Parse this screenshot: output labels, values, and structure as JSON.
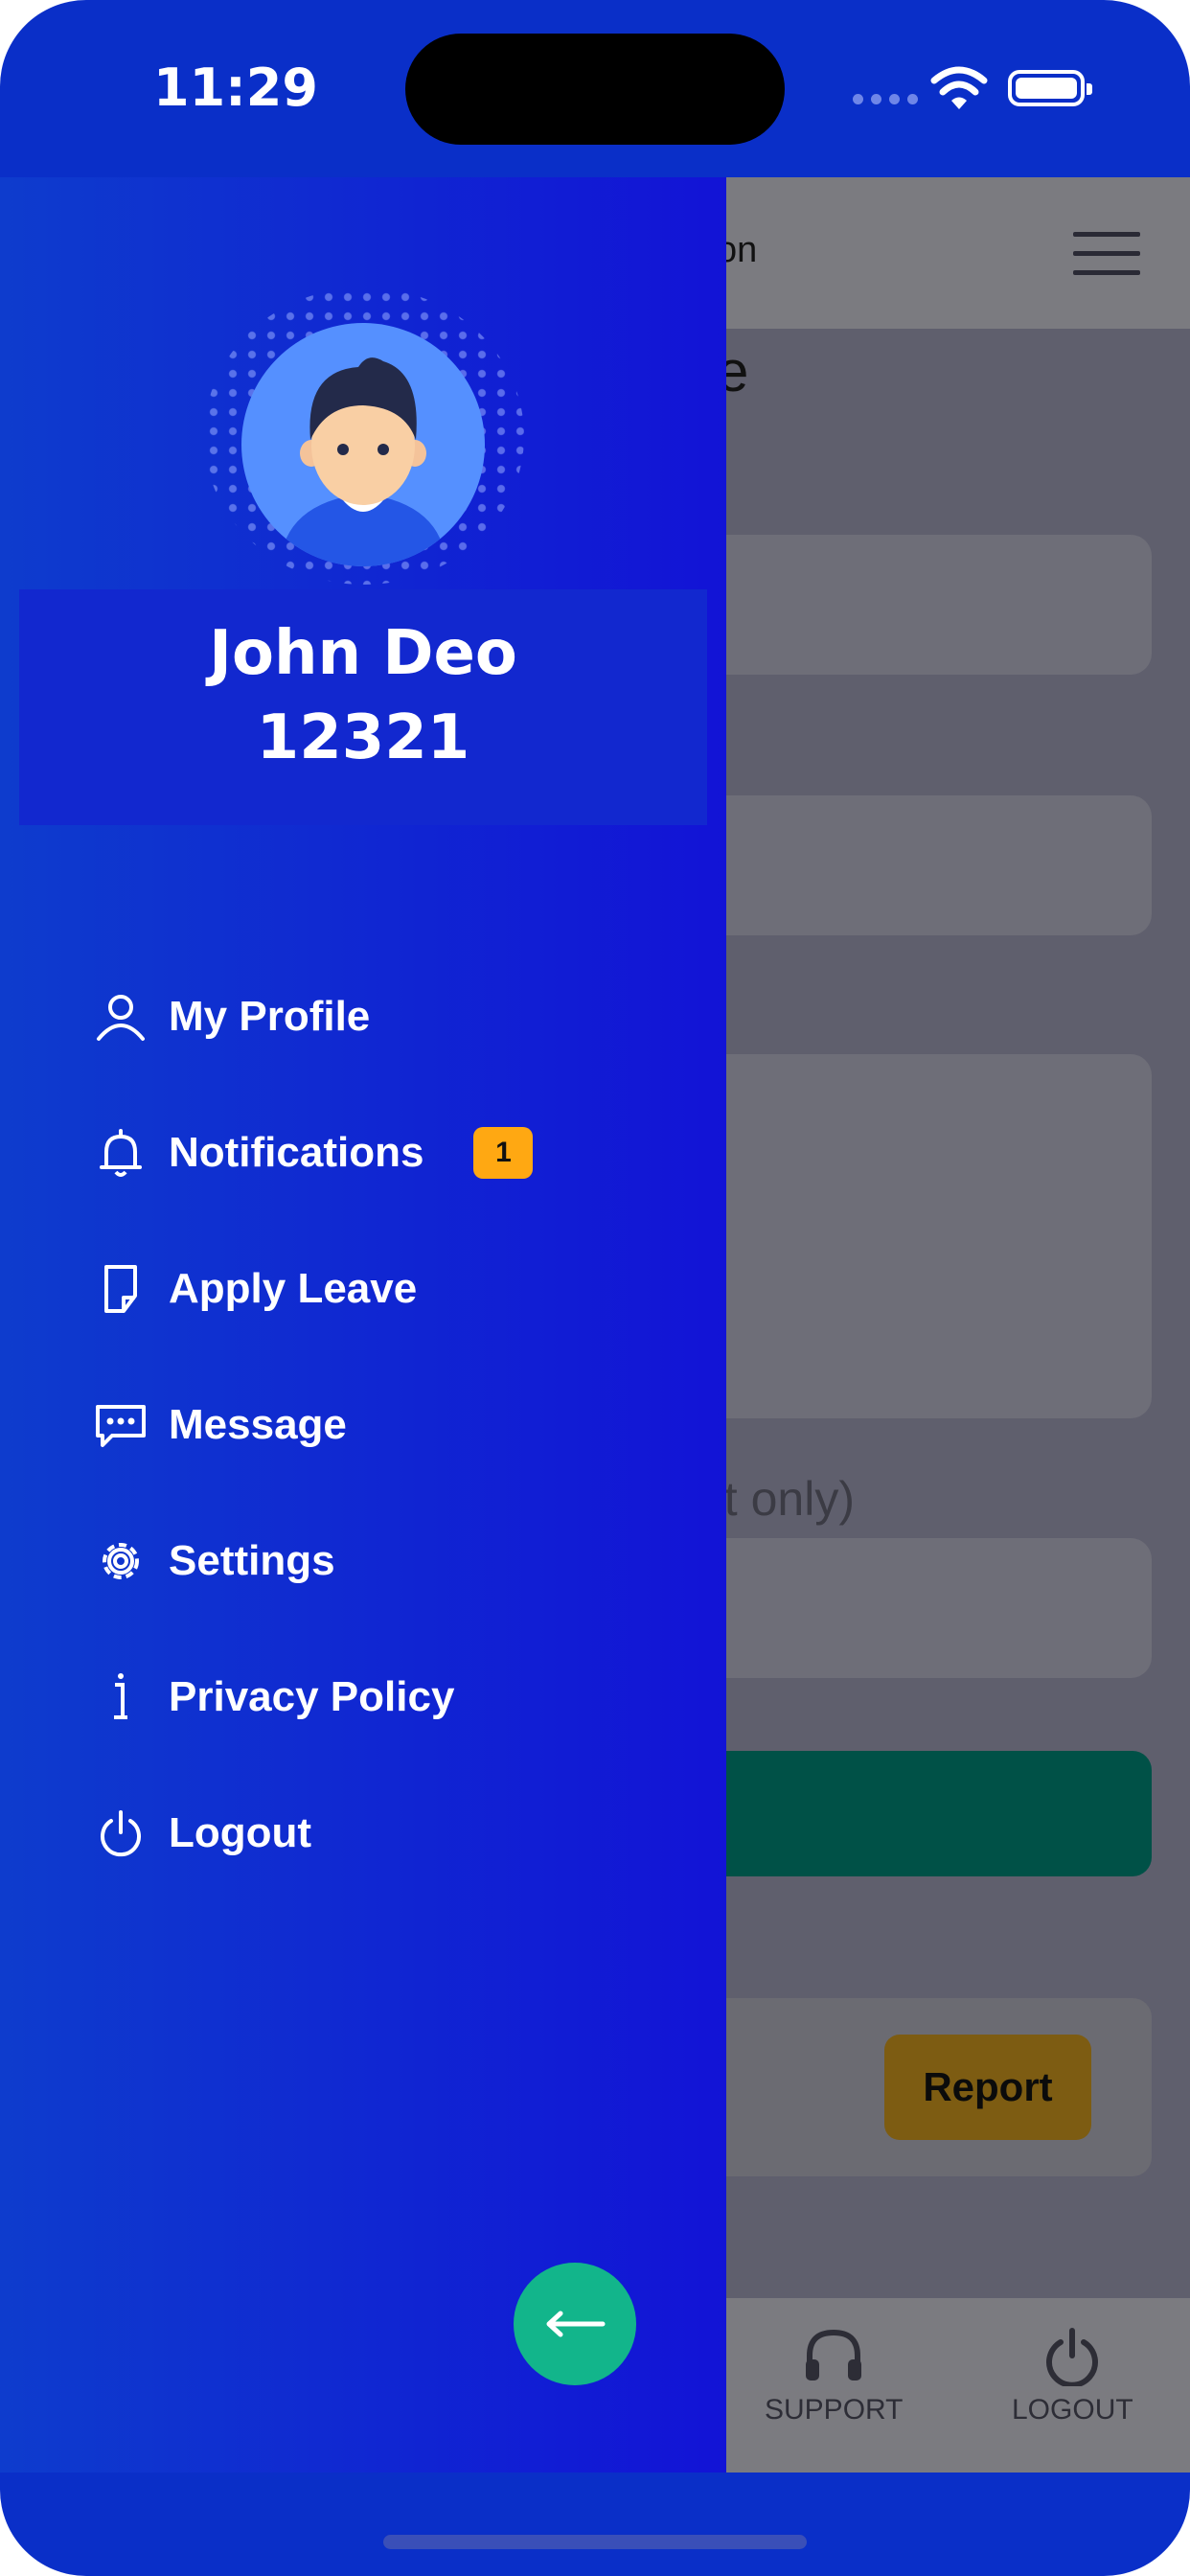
{
  "status_bar": {
    "time": "11:29"
  },
  "background_app": {
    "header_title_fragment": "on",
    "page_title_fragment": "e",
    "hint_fragment": "nt only)",
    "report_label": "Report",
    "tabs": [
      {
        "label": "SUPPORT",
        "icon": "headset-icon"
      },
      {
        "label": "LOGOUT",
        "icon": "power-icon"
      }
    ]
  },
  "drawer": {
    "user": {
      "name": "John Deo",
      "id": "12321"
    },
    "menu": [
      {
        "label": "My Profile",
        "icon": "user-icon"
      },
      {
        "label": "Notifications",
        "icon": "bell-icon",
        "badge": "1"
      },
      {
        "label": "Apply Leave",
        "icon": "document-icon"
      },
      {
        "label": "Message",
        "icon": "chat-icon"
      },
      {
        "label": "Settings",
        "icon": "gear-icon"
      },
      {
        "label": "Privacy Policy",
        "icon": "info-icon"
      },
      {
        "label": "Logout",
        "icon": "power-icon"
      }
    ],
    "close_icon": "arrow-left-icon"
  },
  "colors": {
    "drawer_start": "#0e3ccd",
    "drawer_end": "#1213d6",
    "badge": "#ffa812",
    "fab": "#12b58b",
    "submit": "#005147"
  }
}
